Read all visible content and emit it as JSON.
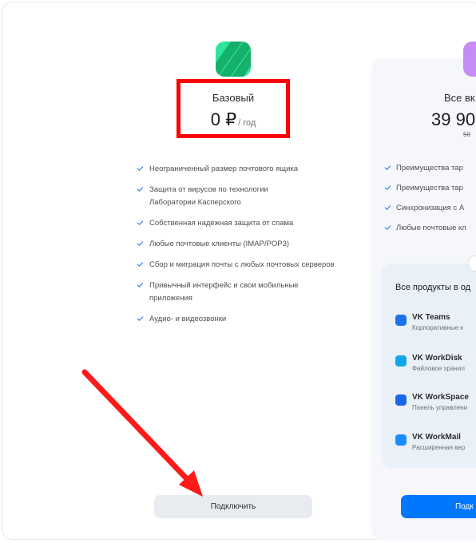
{
  "basic_plan": {
    "name": "Базовый",
    "price": "0 ₽",
    "period": "/ год",
    "features": [
      "Неограниченный размер почтового ящика",
      "Защита от вирусов по технологии Лаборатории Касперского",
      "Собственная надежная защита от спама",
      "Любые почтовые клиенты (IMAP/POP3)",
      "Сбор и миграция почты с любых почтовых серверов",
      "Привычный интерфейс и свои мобильные приложения",
      "Аудио- и видеозвонки"
    ],
    "button_label": "Подключить"
  },
  "full_plan": {
    "name": "Все вк",
    "price": "39 90",
    "old_price": "50",
    "features": [
      "Преимущества тар",
      "Преимущества тар",
      "Синхронизация с А",
      "Любые почтовые кл"
    ],
    "products_title": "Все продукты в од",
    "products": [
      {
        "name": "VK Teams",
        "desc": "Корпоративные к",
        "color": "#1a73e8"
      },
      {
        "name": "VK WorkDisk",
        "desc": "Файловое хранил",
        "color": "#12a7e8"
      },
      {
        "name": "VK WorkSpace",
        "desc": "Панель управлени",
        "color": "#1768e6"
      },
      {
        "name": "VK WorkMail",
        "desc": "Расширенная вер",
        "color": "#1a8cff"
      }
    ],
    "button_label": "Подк"
  },
  "colors": {
    "accent": "#0077ff",
    "highlight": "#ff0000",
    "arrow": "#ff1a1a"
  }
}
